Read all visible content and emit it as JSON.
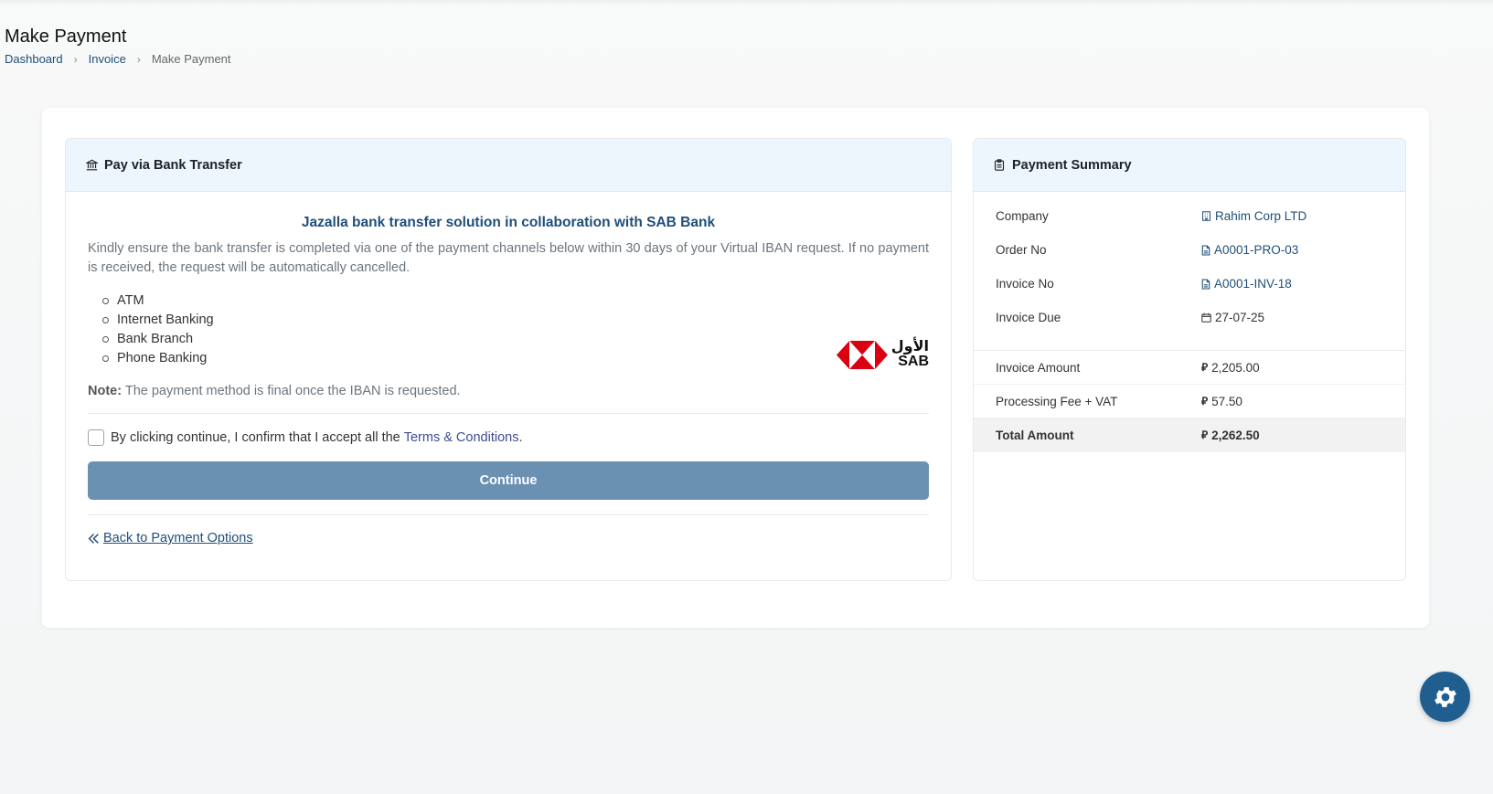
{
  "page": {
    "title": "Make Payment",
    "breadcrumb": [
      "Dashboard",
      "Invoice",
      "Make Payment"
    ]
  },
  "left_panel": {
    "header": "Pay via Bank Transfer",
    "title": "Jazalla bank transfer solution in collaboration with SAB Bank",
    "description": "Kindly ensure the bank transfer is completed via one of the payment channels below within 30 days of your Virtual IBAN request. If no payment is received, the request will be automatically cancelled.",
    "channels": [
      "ATM",
      "Internet Banking",
      "Bank Branch",
      "Phone Banking"
    ],
    "logo": {
      "arabic": "الأول",
      "english": "SAB"
    },
    "note_label": "Note:",
    "note_text": "The payment method is final once the IBAN is requested.",
    "terms_text": "By clicking continue, I confirm that I accept all the",
    "terms_link": "Terms & Conditions",
    "terms_suffix": ".",
    "continue_label": "Continue",
    "back_label": "Back to Payment Options"
  },
  "summary": {
    "header": "Payment Summary",
    "company_label": "Company",
    "company_value": "Rahim Corp LTD",
    "order_label": "Order No",
    "order_value": "A0001-PRO-03",
    "invoice_label": "Invoice No",
    "invoice_value": "A0001-INV-18",
    "due_label": "Invoice Due",
    "due_value": "27-07-25",
    "amount_label": "Invoice Amount",
    "amount_value": "2,205.00",
    "fee_label": "Processing Fee + VAT",
    "fee_value": "57.50",
    "total_label": "Total Amount",
    "total_value": "2,262.50",
    "currency_symbol": "⃁"
  },
  "colors": {
    "brand": "#1f4e79",
    "button": "#6a91b2",
    "header_bg": "#eef6fd",
    "sab_red": "#db0011"
  },
  "icons": [
    "bank-icon",
    "clipboard-icon",
    "building-icon",
    "file-icon",
    "calendar-icon",
    "double-chevron-left-icon",
    "gear-icon"
  ]
}
